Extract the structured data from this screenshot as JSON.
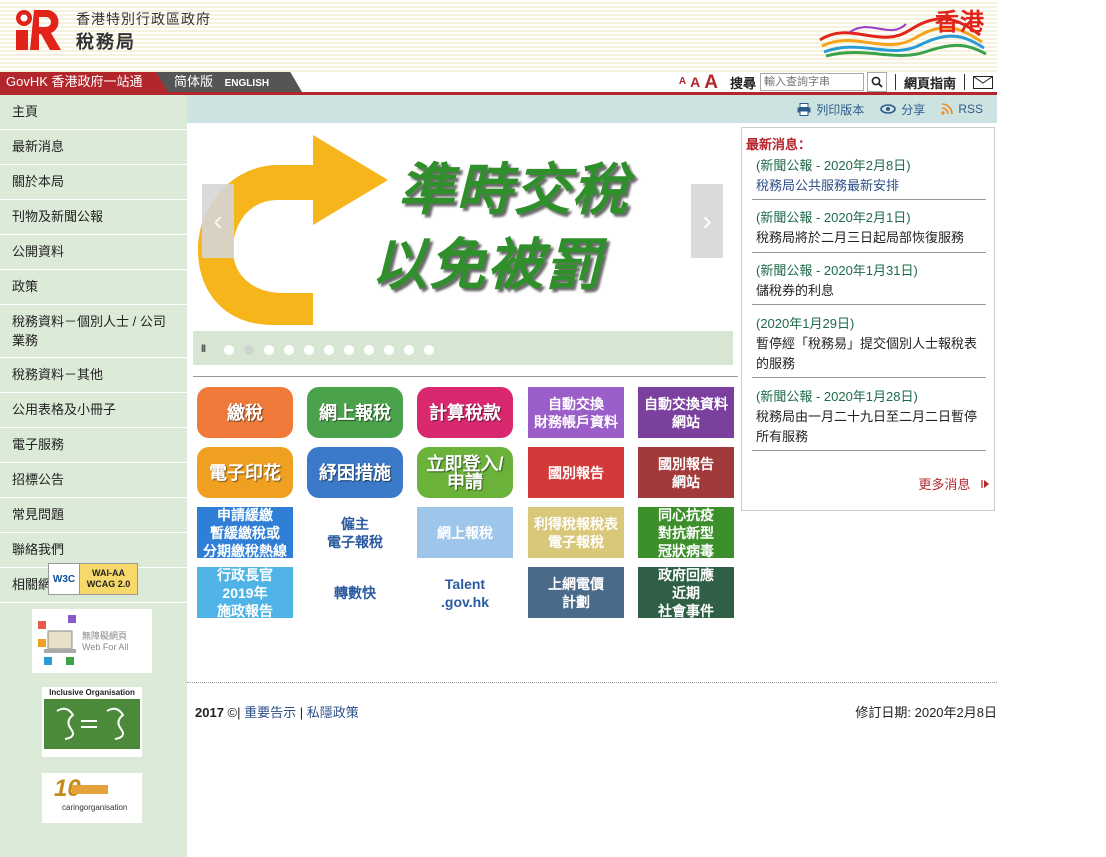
{
  "header": {
    "dept_title_line1": "香港特別行政區政府",
    "dept_title_line2": "稅務局",
    "brand_text": "香港"
  },
  "nav": {
    "govhk": "GovHK 香港政府一站通",
    "lang_simplified": "简体版",
    "lang_english": "ENGLISH",
    "font_small": "A",
    "font_medium": "A",
    "font_large": "A",
    "search_label": "搜尋",
    "search_placeholder": "輸入查詢字串",
    "site_guide": "網頁指南"
  },
  "sidebar": {
    "items": [
      {
        "label": "主頁"
      },
      {
        "label": "最新消息"
      },
      {
        "label": "關於本局"
      },
      {
        "label": "刊物及新聞公報"
      },
      {
        "label": "公開資料"
      },
      {
        "label": "政策"
      },
      {
        "label": "稅務資料－個別人士 / 公司業務"
      },
      {
        "label": "稅務資料－其他"
      },
      {
        "label": "公用表格及小冊子"
      },
      {
        "label": "電子服務"
      },
      {
        "label": "招標公告"
      },
      {
        "label": "常見問題"
      },
      {
        "label": "聯絡我們"
      },
      {
        "label": "相關網址"
      }
    ],
    "badges": {
      "wcag_w3c": "W3C",
      "wcag_level": "WAI-AA",
      "wcag_version": "WCAG 2.0",
      "webforall_zh": "無障礙網頁",
      "webforall_en": "Web For All",
      "inclusive_title": "Inclusive Organisation",
      "caring_years": "10",
      "caring_name": "caringorganisation"
    }
  },
  "utility": {
    "print": "列印版本",
    "share": "分享",
    "rss": "RSS"
  },
  "banner": {
    "line1": "準時交稅",
    "line2": "以免被罰",
    "prev": "‹",
    "next": "›",
    "pause": "II",
    "dots": 11,
    "active_dot": 1
  },
  "tiles": [
    {
      "label": "繳稅",
      "bg": "#f07a3a"
    },
    {
      "label": "網上報稅",
      "bg": "#4aa34a"
    },
    {
      "label": "計算稅款",
      "bg": "#d9286f"
    },
    {
      "label": "自動交換\n財務帳戶資料",
      "bg": "#9b5dc8"
    },
    {
      "label": "自動交換資料\n網站",
      "bg": "#7b3f9e"
    },
    {
      "label": "電子印花",
      "bg": "#f0a020"
    },
    {
      "label": "紓困措施",
      "bg": "#3b79c9"
    },
    {
      "label": "立即登入/\n申請",
      "bg": "#6ab23a"
    },
    {
      "label": "國別報告",
      "bg": "#d23a3a"
    },
    {
      "label": "國別報告\n網站",
      "bg": "#a23a3a"
    },
    {
      "label": "申請緩繳\n暫緩繳稅或\n分期繳稅熱線",
      "bg": "#2f7fd6"
    },
    {
      "label": "僱主\n電子報稅",
      "bg": "#ffffff"
    },
    {
      "label": "網上報稅",
      "bg": "#9ec6ea"
    },
    {
      "label": "利得稅報稅表\n電子報稅",
      "bg": "#d9c77a"
    },
    {
      "label": "同心抗疫\n對抗新型\n冠狀病毒",
      "bg": "#3c8f2a"
    },
    {
      "label": "行政長官\n2019年\n施政報告",
      "bg": "#4fb3e6"
    },
    {
      "label": "轉數快",
      "bg": "#ffffff"
    },
    {
      "label": "Talent\n.gov.hk",
      "bg": "#ffffff"
    },
    {
      "label": "上網電價\n計劃",
      "bg": "#4a6a8a"
    },
    {
      "label": "政府回應\n近期\n社會事件",
      "bg": "#2f5f45"
    }
  ],
  "news": {
    "title": "最新消息：",
    "items": [
      {
        "date": "(新聞公報 - 2020年2月8日)",
        "body": "稅務局公共服務最新安排"
      },
      {
        "date": "(新聞公報 - 2020年2月1日)",
        "body": "稅務局將於二月三日起局部恢復服務"
      },
      {
        "date": "(新聞公報 - 2020年1月31日)",
        "body": "儲稅券的利息"
      },
      {
        "date": "(2020年1月29日)",
        "body": "暫停經「稅務易」提交個別人士報稅表的服務"
      },
      {
        "date": "(新聞公報 - 2020年1月28日)",
        "body": "稅務局由一月二十九日至二月二日暫停所有服務"
      }
    ],
    "more": "更多消息"
  },
  "footer": {
    "year": "2017",
    "copy": "©|",
    "notices": "重要告示",
    "divider": "|",
    "privacy": "私隱政策",
    "revised": "修訂日期: 2020年2月8日"
  },
  "colors": {
    "brand_red": "#b3262c",
    "sidebar_bg": "#dcead8",
    "util_bg": "#cde3e2",
    "banner_green": "#2f8f2a"
  }
}
